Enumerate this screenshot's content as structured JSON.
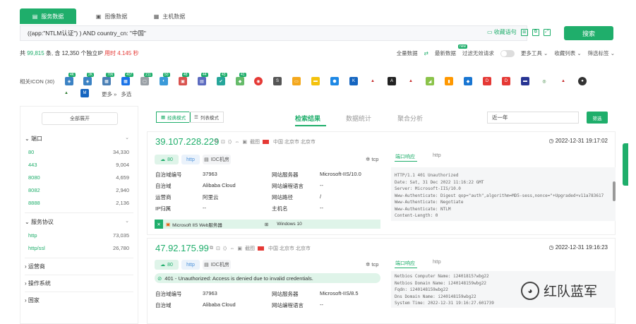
{
  "tabs": [
    {
      "label": "服务数据",
      "icon": "service-icon"
    },
    {
      "label": "图像数据",
      "icon": "image-icon"
    },
    {
      "label": "主机数据",
      "icon": "host-icon"
    }
  ],
  "search": {
    "query": "((app:\"NTLM认证\") ) AND country_cn: \"中国\"",
    "save_label": "收藏语句",
    "button_label": "搜索"
  },
  "summary": {
    "prefix": "共",
    "total": "99,815",
    "middle": "条, 含",
    "ips": "12,350",
    "ips_suffix": "个独立IP",
    "took": "用时 4.145 秒"
  },
  "options": {
    "all_data": "全量数据",
    "latest_data": "最新数据",
    "new_badge": "new",
    "filter_honeypot": "过滤无效请求",
    "more_tools": "更多工具",
    "favorites": "收藏列表",
    "filter_tags": "筛选标签"
  },
  "related_icons": {
    "label": "相关ICON (30)",
    "counts": [
      "4K",
      "2K",
      "706",
      "407",
      "211",
      "50",
      "48",
      "44",
      "43",
      "41"
    ],
    "more": "更多",
    "multi_select": "多选"
  },
  "left_panel": {
    "expand_all": "全部展开",
    "port_title": "端口",
    "ports": [
      {
        "key": "80",
        "count": "34,330"
      },
      {
        "key": "443",
        "count": "9,004"
      },
      {
        "key": "8080",
        "count": "4,659"
      },
      {
        "key": "8082",
        "count": "2,940"
      },
      {
        "key": "8888",
        "count": "2,136"
      }
    ],
    "protocol_title": "服务协议",
    "protocols": [
      {
        "key": "http",
        "count": "73,035"
      },
      {
        "key": "http/ssl",
        "count": "26,780"
      }
    ],
    "isp_title": "运营商",
    "os_title": "操作系统",
    "country_title": "国家"
  },
  "view": {
    "classic_mode": "经典模式",
    "list_mode": "列表模式",
    "tab_results": "检索结果",
    "tab_stats": "数据统计",
    "tab_aggregate": "聚合分析",
    "year_select": "近一年",
    "filter_btn": "筛选"
  },
  "results": [
    {
      "ip": "39.107.228.229",
      "sc_label": "截图",
      "location": "中国 北京市 北京市",
      "time": "2022-12-31 19:17:02",
      "port": "80",
      "proto": "http",
      "idc": "IDC机房",
      "fields": {
        "asn_label": "自治域编号",
        "asn": "37963",
        "asname_label": "自治域",
        "asname": "Alibaba Cloud",
        "isp_label": "运营商",
        "isp": "阿里云",
        "ipattr_label": "IP归属",
        "ipattr": "--",
        "server_label": "网站服务器",
        "server": "Microsoft-IIS/10.0",
        "lang_label": "网站编程语言",
        "lang": "--",
        "path_label": "网站路径",
        "path": "/",
        "host_label": "主机名",
        "host": "--"
      },
      "tech1": "Microsoft IIS Web服务器",
      "tech2": "Windows 10",
      "resp_tab": "端口响应",
      "resp_tab2": "http",
      "tcp": "tcp",
      "response": "HTTP/1.1 401 Unauthorized\nDate: Sat, 31 Dec 2022 11:16:22 GMT\nServer: Microsoft-IIS/10.0\nWww-Authenticate: Digest qop=\"auth\",algorithm=MD5-sess,nonce=\"+Upgraded+v11a783617\nWww-Authenticate: Negotiate\nWww-Authenticate: NTLM\nContent-Length: 0"
    },
    {
      "ip": "47.92.175.99",
      "sc_label": "截图",
      "location": "中国 北京市 北京市",
      "time": "2022-12-31 19:16:23",
      "port": "80",
      "proto": "http",
      "idc": "IDC机房",
      "alert": "401 - Unauthorized: Access is denied due to invalid credentials.",
      "fields": {
        "asn_label": "自治域编号",
        "asn": "37963",
        "asname_label": "自治域",
        "asname": "Alibaba Cloud",
        "server_label": "网站服务器",
        "server": "Microsoft-IIS/8.5",
        "lang_label": "网站编程语言",
        "lang": "--"
      },
      "resp_tab": "端口响应",
      "resp_tab2": "http",
      "tcp": "tcp",
      "response": "Netbios Computer Name: i2401815?wbg22\nNetbios Domain Name: i240148159wbg22\nFqdn: i240148159wbg22\nDns Domain Name: i240148159wbg22\nSystem Time: 2022-12-31 19:16:27.601739"
    }
  ],
  "watermark": "红队蓝军",
  "colors": {
    "accent": "#1fae6b",
    "red": "#e53935"
  }
}
